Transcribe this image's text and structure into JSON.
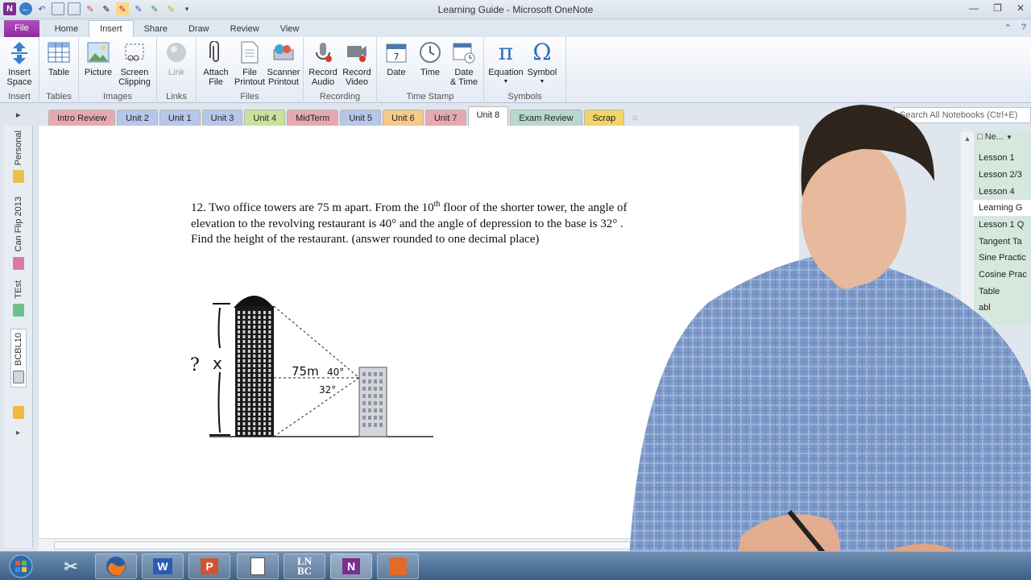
{
  "window": {
    "title": "Learning Guide - Microsoft OneNote"
  },
  "ribbon_tabs": [
    "File",
    "Home",
    "Insert",
    "Share",
    "Draw",
    "Review",
    "View"
  ],
  "ribbon": {
    "insert_group": {
      "label": "Insert",
      "space": "Insert\nSpace"
    },
    "tables_group": {
      "label": "Tables",
      "table": "Table"
    },
    "images_group": {
      "label": "Images",
      "picture": "Picture",
      "screen_clipping": "Screen\nClipping"
    },
    "links_group": {
      "label": "Links",
      "link": "Link"
    },
    "files_group": {
      "label": "Files",
      "attach_file": "Attach\nFile",
      "file_printout": "File\nPrintout",
      "scanner_printout": "Scanner\nPrintout"
    },
    "recording_group": {
      "label": "Recording",
      "record_audio": "Record\nAudio",
      "record_video": "Record\nVideo"
    },
    "timestamp_group": {
      "label": "Time Stamp",
      "date": "Date",
      "time": "Time",
      "date_time": "Date\n& Time"
    },
    "symbols_group": {
      "label": "Symbols",
      "equation": "Equation",
      "symbol": "Symbol"
    }
  },
  "sections": [
    {
      "label": "Intro Review",
      "color": "#e7a9b1"
    },
    {
      "label": "Unit 2",
      "color": "#b7c7ea"
    },
    {
      "label": "Unit 1",
      "color": "#b7c7ea"
    },
    {
      "label": "Unit 3",
      "color": "#b7c7ea"
    },
    {
      "label": "Unit 4",
      "color": "#c8e29b"
    },
    {
      "label": "MidTerm",
      "color": "#e7a9b1"
    },
    {
      "label": "Unit 5",
      "color": "#b7c7ea"
    },
    {
      "label": "Unit 6",
      "color": "#f3c98c"
    },
    {
      "label": "Unit 7",
      "color": "#e7a9b1"
    },
    {
      "label": "Unit 8",
      "color": "#ffffff"
    },
    {
      "label": "Exam Review",
      "color": "#b8d7ce"
    },
    {
      "label": "Scrap",
      "color": "#f3d36b"
    }
  ],
  "search": {
    "placeholder": "Search All Notebooks (Ctrl+E)"
  },
  "notebooks": [
    {
      "label": "Personal",
      "color": "#e8c24a"
    },
    {
      "label": "Can Flip 2013",
      "color": "#d97aa3"
    },
    {
      "label": "TEst",
      "color": "#6fbf8a"
    },
    {
      "label": "BCBL10",
      "color": "#cfd6df"
    }
  ],
  "pages": {
    "new_page": "Ne...",
    "items": [
      "Lesson 1",
      "Lesson 2/3",
      "Lesson 4",
      "Learning G",
      "Lesson 1 Q",
      "Tangent Ta",
      "Sine Practic",
      "Cosine Prac",
      "Table",
      "abl"
    ]
  },
  "question": {
    "line1_before": "12. Two office towers are 75 m apart. From the 10",
    "line1_sup": "th",
    "line1_after": " floor of the shorter tower, the angle of",
    "line2": "elevation to the revolving restaurant is  40° and the angle of depression  to the base is 32° .",
    "line3": "Find the height of the restaurant. (answer rounded to one decimal place)"
  },
  "handwriting": {
    "unknown": "?",
    "x_label": "x",
    "distance": "75m",
    "elevation": "40°",
    "depression": "32°"
  },
  "taskbar": [
    "start",
    "snipping-tool",
    "firefox",
    "W",
    "P",
    "notepad",
    "LN BC",
    "N",
    "pdf"
  ]
}
